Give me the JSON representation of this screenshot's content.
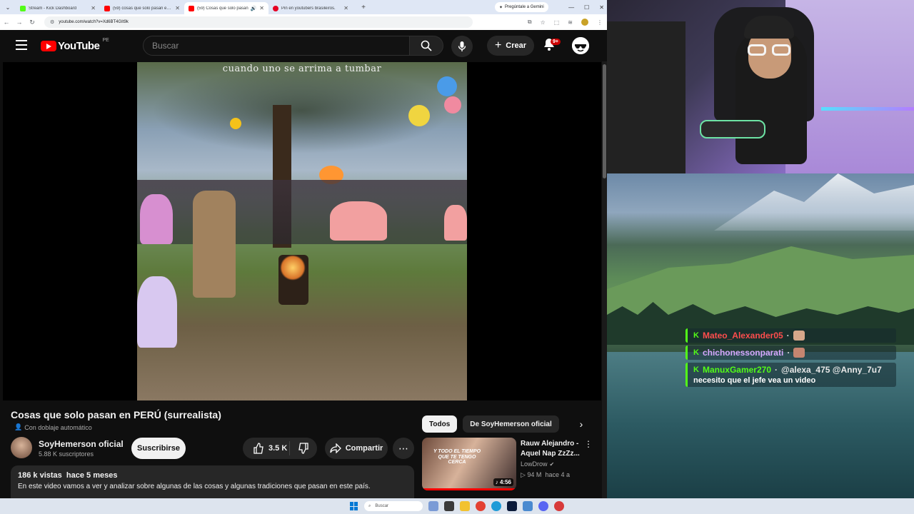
{
  "browser": {
    "tabs": [
      {
        "title": "Stream - Kick Dashboard",
        "favicon_color": "#53fc18",
        "active": false
      },
      {
        "title": "(59) cosas que solo pasan en p",
        "favicon_color": "#ff0000",
        "active": false
      },
      {
        "title": "(59) Cosas que solo pasan",
        "favicon_color": "#ff0000",
        "active": true
      },
      {
        "title": "Pin en youtubers brasileiros.",
        "favicon_color": "#e60023",
        "active": false
      }
    ],
    "gemini_label": "Pregúntale a Gemini",
    "url": "youtube.com/watch?v=Xd6BT4GIt9k"
  },
  "youtube": {
    "logo_text": "YouTube",
    "country_code": "PE",
    "search_placeholder": "Buscar",
    "create_label": "Crear",
    "notifications_badge": "9+",
    "video_caption": "cuando uno se arrima a tumbar",
    "video_title": "Cosas que solo pasan en PERÚ (surrealista)",
    "dub_label": "Con doblaje automático",
    "channel_name": "SoyHemerson oficial",
    "subscribers": "5.88 K suscriptores",
    "subscribe_label": "Suscribirse",
    "likes": "3.5 K",
    "share_label": "Compartir",
    "views": "186 k vistas",
    "age": "hace 5 meses",
    "description": "En este video vamos a ver y analizar sobre algunas de las cosas y algunas tradiciones que pasan en este país.",
    "chips": [
      "Todos",
      "De SoyHemerson oficial"
    ],
    "recommendation": {
      "title": "Rauw Alejandro - Aquel Nap ZzZz...",
      "channel": "LowDrow",
      "views": "94 M",
      "age": "hace 4 a",
      "duration": "4:56",
      "thumb_text": "Y TODO EL TIEMPO QUE TE TENGO CERCA"
    }
  },
  "chat": {
    "messages": [
      {
        "user": "Mateo_Alexander05",
        "user_color": "#ff4d4d",
        "text": ""
      },
      {
        "user": "chichonessonparati",
        "user_color": "#d7a8ff",
        "text": ""
      },
      {
        "user": "ManuxGamer270",
        "user_color": "#53fc18",
        "mention": "@alexa_475 @Anny_7u7",
        "text": "necesito que el jefe vea un video"
      }
    ],
    "platform_icon": "K"
  },
  "taskbar": {
    "search_placeholder": "Buscar"
  }
}
